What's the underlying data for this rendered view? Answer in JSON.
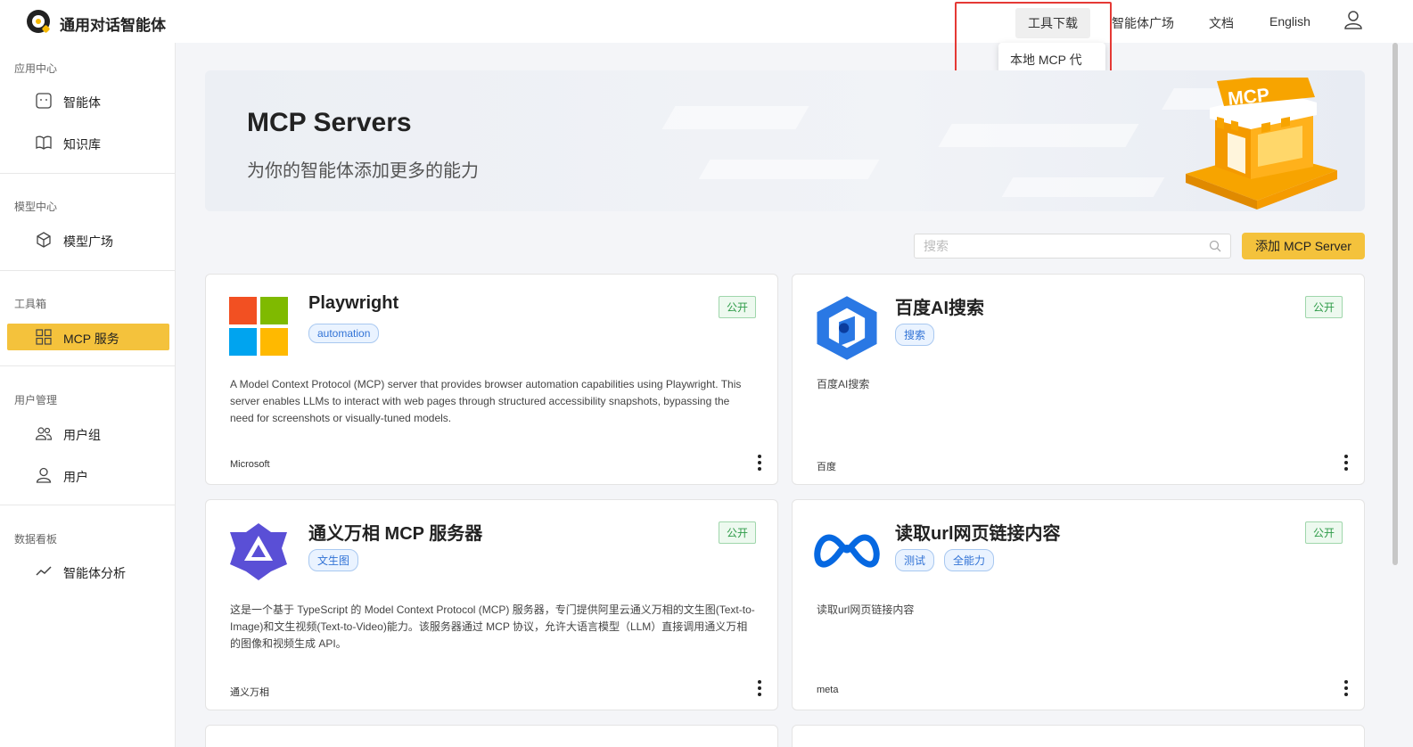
{
  "header": {
    "app_title": "通用对话智能体",
    "nav": [
      {
        "label": "工具下载",
        "active": true
      },
      {
        "label": "智能体广场"
      },
      {
        "label": "文档"
      },
      {
        "label": "English"
      }
    ],
    "user_icon": "user-icon",
    "dropdown_item": "本地 MCP 代理"
  },
  "sidebar": {
    "sections": [
      {
        "title": "应用中心",
        "items": [
          {
            "label": "智能体",
            "icon": "agent-icon"
          },
          {
            "label": "知识库",
            "icon": "book-icon"
          }
        ]
      },
      {
        "title": "模型中心",
        "items": [
          {
            "label": "模型广场",
            "icon": "cube-icon"
          }
        ]
      },
      {
        "title": "工具箱",
        "items": [
          {
            "label": "MCP 服务",
            "icon": "grid-icon",
            "active": true
          }
        ]
      },
      {
        "title": "用户管理",
        "items": [
          {
            "label": "用户组",
            "icon": "users-icon"
          },
          {
            "label": "用户",
            "icon": "user-icon"
          }
        ]
      },
      {
        "title": "数据看板",
        "items": [
          {
            "label": "智能体分析",
            "icon": "chart-line-icon"
          }
        ]
      }
    ]
  },
  "banner": {
    "title": "MCP Servers",
    "subtitle": "为你的智能体添加更多的能力",
    "illustration_text": "MCP"
  },
  "toolbar": {
    "search_placeholder": "搜索",
    "add_button": "添加 MCP Server"
  },
  "cards": [
    {
      "name": "Playwright",
      "tags": [
        "automation"
      ],
      "badge": "公开",
      "icon": "microsoft-logo-icon",
      "description": "A Model Context Protocol (MCP) server that provides browser automation capabilities using Playwright. This server enables LLMs to interact with web pages through structured accessibility snapshots, bypassing the need for screenshots or visually-tuned models.",
      "owner": "Microsoft"
    },
    {
      "name": "百度AI搜索",
      "tags": [
        "搜索"
      ],
      "badge": "公开",
      "icon": "baidu-search-logo-icon",
      "description": "百度AI搜索",
      "owner": "百度"
    },
    {
      "name": "通义万相 MCP 服务器",
      "tags": [
        "文生图"
      ],
      "badge": "公开",
      "icon": "tongyi-logo-icon",
      "description": "这是一个基于 TypeScript 的 Model Context Protocol (MCP) 服务器，专门提供阿里云通义万相的文生图(Text-to-Image)和文生视频(Text-to-Video)能力。该服务器通过 MCP 协议，允许大语言模型（LLM）直接调用通义万相的图像和视频生成 API。",
      "owner": "通义万相"
    },
    {
      "name": "读取url网页链接内容",
      "tags": [
        "测试",
        "全能力"
      ],
      "badge": "公开",
      "icon": "meta-logo-icon",
      "description": "读取url网页链接内容",
      "owner": "meta"
    }
  ],
  "colors": {
    "accent": "#f4c23c",
    "badge_green": "#2e9b48",
    "tag_blue": "#3273d6",
    "annotation_red": "#e53935"
  }
}
